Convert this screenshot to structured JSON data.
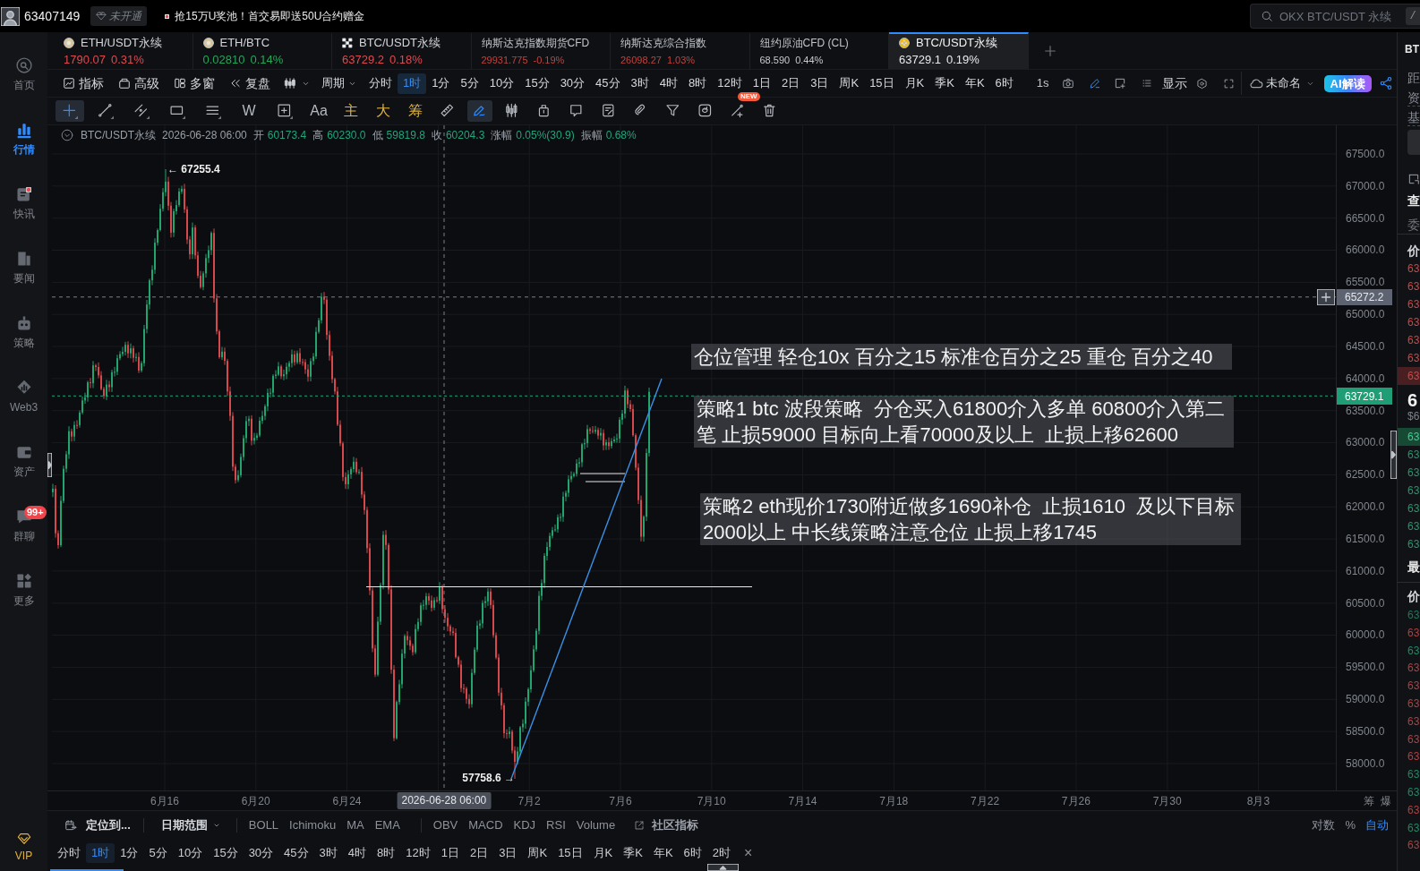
{
  "top_bar": {
    "account_id": "63407149",
    "membership_badge": "未开通",
    "promo_text": "抢15万U奖池！首交易即送50U合约赠金",
    "search": {
      "placeholder": "OKX BTC/USDT 永续",
      "shortcut": "/"
    }
  },
  "sidebar": {
    "items": [
      {
        "label": "首页",
        "selected": false,
        "unread": false
      },
      {
        "label": "行情",
        "selected": true,
        "unread": false
      },
      {
        "label": "快讯",
        "selected": false,
        "unread": true
      },
      {
        "label": "要闻",
        "selected": false,
        "unread": false
      },
      {
        "label": "策略",
        "selected": false,
        "unread": false
      },
      {
        "label": "Web3",
        "selected": false,
        "unread": false
      },
      {
        "label": "资产",
        "selected": false,
        "unread": false
      },
      {
        "label": "群聊",
        "selected": false,
        "unread": false,
        "badge": "99+"
      },
      {
        "label": "更多",
        "selected": false,
        "unread": false
      }
    ],
    "vip_label": "VIP"
  },
  "instrument_tabs": [
    {
      "kind": "pair",
      "name": "ETH/USDT永续",
      "price": "1790.07",
      "change": "0.31%",
      "color": "#e0494e",
      "selected": false
    },
    {
      "kind": "pair",
      "name": "ETH/BTC",
      "price": "0.02810",
      "change": "0.14%",
      "color": "#26a65b",
      "selected": false
    },
    {
      "kind": "pair",
      "name": "BTC/USDT永续",
      "price": "63729.2",
      "change": "0.18%",
      "color": "#e0494e",
      "selected": false
    },
    {
      "kind": "index",
      "name": "纳斯达克指数期货CFD",
      "price": "29931.775",
      "change": "-0.19%",
      "color": "#c0433f",
      "selected": false
    },
    {
      "kind": "index",
      "name": "纳斯达克综合指数",
      "price": "26098.27",
      "change": "1.03%",
      "color": "#c0433f",
      "selected": false
    },
    {
      "kind": "index",
      "name": "纽约原油CFD (CL)",
      "price": "68.590",
      "change": "0.44%",
      "color": "#c8cacd",
      "selected": false
    },
    {
      "kind": "pair",
      "name": "BTC/USDT永续",
      "price": "63729.1",
      "change": "0.19%",
      "color": "#e8e9eb",
      "selected": true
    }
  ],
  "toolbar": {
    "tools": [
      "指标",
      "高级",
      "多窗",
      "复盘"
    ],
    "period_label": "周期",
    "intervals": [
      {
        "label": "分时",
        "selected": false
      },
      {
        "label": "1时",
        "selected": true
      },
      {
        "label": "1分",
        "selected": false
      },
      {
        "label": "5分",
        "selected": false
      },
      {
        "label": "10分",
        "selected": false
      },
      {
        "label": "15分",
        "selected": false
      },
      {
        "label": "30分",
        "selected": false
      },
      {
        "label": "45分",
        "selected": false
      },
      {
        "label": "3时",
        "selected": false
      },
      {
        "label": "4时",
        "selected": false
      },
      {
        "label": "8时",
        "selected": false
      },
      {
        "label": "12时",
        "selected": false
      },
      {
        "label": "1日",
        "selected": false
      },
      {
        "label": "2日",
        "selected": false
      },
      {
        "label": "3日",
        "selected": false
      },
      {
        "label": "周K",
        "selected": false
      },
      {
        "label": "15日",
        "selected": false
      },
      {
        "label": "月K",
        "selected": false
      },
      {
        "label": "季K",
        "selected": false
      },
      {
        "label": "年K",
        "selected": false
      },
      {
        "label": "6时",
        "selected": false
      }
    ],
    "tick_interval": "1s",
    "display_label": "显示",
    "layout_name": "未命名",
    "ai_button": "AI解读"
  },
  "drawing_tools": [
    {
      "kind": "icon",
      "selected": true
    },
    {
      "kind": "icon",
      "selected": false
    },
    {
      "kind": "icon",
      "selected": false
    },
    {
      "kind": "icon",
      "selected": false
    },
    {
      "kind": "icon",
      "selected": false
    },
    {
      "kind": "text",
      "label": "W",
      "selected": false
    },
    {
      "kind": "icon",
      "selected": false
    },
    {
      "kind": "text",
      "label": "Aa",
      "selected": false
    },
    {
      "kind": "accent",
      "label": "主",
      "selected": false
    },
    {
      "kind": "accent",
      "label": "大",
      "selected": false
    },
    {
      "kind": "accent",
      "label": "筹",
      "selected": false
    },
    {
      "kind": "icon",
      "selected": false
    },
    {
      "kind": "icon",
      "selected": true
    },
    {
      "kind": "icon",
      "selected": false
    },
    {
      "kind": "icon",
      "selected": false
    },
    {
      "kind": "icon",
      "selected": false
    },
    {
      "kind": "icon",
      "selected": false
    },
    {
      "kind": "icon",
      "selected": false
    },
    {
      "kind": "icon",
      "selected": false
    },
    {
      "kind": "icon",
      "selected": false
    },
    {
      "kind": "icon",
      "selected": false,
      "badge": "NEW"
    },
    {
      "kind": "icon",
      "selected": false
    }
  ],
  "chart": {
    "symbol": "BTC/USDT永续",
    "time": "2026-06-28 06:00",
    "ohlc": [
      {
        "label": "开",
        "value": "60173.4"
      },
      {
        "label": "高",
        "value": "60230.0"
      },
      {
        "label": "低",
        "value": "59819.8"
      },
      {
        "label": "收",
        "value": "60204.3"
      },
      {
        "label": "涨幅",
        "value": "0.05%(30.9)"
      },
      {
        "label": "振幅",
        "value": "0.68%"
      }
    ],
    "high_label": "← 67255.4",
    "low_label": "57758.6 →",
    "notes": [
      "仓位管理 轻仓10x 百分之15 标准仓百分之25 重仓 百分之40",
      "策略1 btc 波段策略  分仓买入61800介入多单 60800介入第二笔 止损59000 目标向上看70000及以上  止损上移62600",
      "策略2 eth现价1730附近做多1690补仓  止损1610  及以下目标2000以上 中长线策略注意仓位 止损上移1745"
    ],
    "price_axis": [
      "67500.0",
      "67000.0",
      "66500.0",
      "66000.0",
      "65500.0",
      "65000.0",
      "64500.0",
      "64000.0",
      "63500.0",
      "63000.0",
      "62500.0",
      "62000.0",
      "61500.0",
      "61000.0",
      "60500.0",
      "60000.0",
      "59500.0",
      "59000.0",
      "58500.0",
      "58000.0"
    ],
    "crosshair_price": "65272.2",
    "last_price": "63729.1",
    "date_axis": [
      "6月16",
      "6月20",
      "6月24",
      "7月2",
      "7月6",
      "7月10",
      "7月14",
      "7月18",
      "7月22",
      "7月26",
      "7月30",
      "8月3"
    ],
    "cursor_time": "2026-06-28 06:00",
    "axis_corner": [
      "筹",
      "爆"
    ]
  },
  "indicator_bar": {
    "locate_label": "定位到...",
    "date_range_label": "日期范围",
    "main_indicators": [
      "BOLL",
      "Ichimoku",
      "MA",
      "EMA"
    ],
    "sub_indicators": [
      "OBV",
      "MACD",
      "KDJ",
      "RSI",
      "Volume"
    ],
    "community_label": "社区指标",
    "scale_options": [
      {
        "label": "对数",
        "selected": false
      },
      {
        "label": "%",
        "selected": false
      },
      {
        "label": "自动",
        "selected": true
      }
    ]
  },
  "bottom_intervals": {
    "items": [
      {
        "label": "分时",
        "selected": false
      },
      {
        "label": "1时",
        "selected": true
      },
      {
        "label": "1分",
        "selected": false
      },
      {
        "label": "5分",
        "selected": false
      },
      {
        "label": "10分",
        "selected": false
      },
      {
        "label": "15分",
        "selected": false
      },
      {
        "label": "30分",
        "selected": false
      },
      {
        "label": "45分",
        "selected": false
      },
      {
        "label": "3时",
        "selected": false
      },
      {
        "label": "4时",
        "selected": false
      },
      {
        "label": "8时",
        "selected": false
      },
      {
        "label": "12时",
        "selected": false
      },
      {
        "label": "1日",
        "selected": false
      },
      {
        "label": "2日",
        "selected": false
      },
      {
        "label": "3日",
        "selected": false
      },
      {
        "label": "周K",
        "selected": false
      },
      {
        "label": "15日",
        "selected": false
      },
      {
        "label": "月K",
        "selected": false
      },
      {
        "label": "季K",
        "selected": false
      },
      {
        "label": "年K",
        "selected": false
      },
      {
        "label": "6时",
        "selected": false
      },
      {
        "label": "2时",
        "selected": false
      }
    ],
    "close": "×"
  },
  "right_panel": {
    "title": "BT",
    "info_labels": [
      "距",
      "资",
      "基"
    ],
    "heading": "查",
    "subheading": "委",
    "book_header": "价",
    "asks": [
      {
        "text": "63",
        "highlighted": false
      },
      {
        "text": "63",
        "highlighted": false
      },
      {
        "text": "63",
        "highlighted": false
      },
      {
        "text": "63",
        "highlighted": false
      },
      {
        "text": "63",
        "highlighted": false
      },
      {
        "text": "63",
        "highlighted": false
      },
      {
        "text": "63",
        "highlighted": true
      }
    ],
    "last_price": "6",
    "last_price_usd": "$6",
    "bids": [
      {
        "text": "63",
        "highlighted": true
      },
      {
        "text": "63",
        "highlighted": false
      },
      {
        "text": "63",
        "highlighted": false
      },
      {
        "text": "63",
        "highlighted": false
      },
      {
        "text": "63",
        "highlighted": false
      },
      {
        "text": "63",
        "highlighted": false
      },
      {
        "text": "63",
        "highlighted": false
      }
    ],
    "trades_heading": "最",
    "trades_header": "价",
    "trades": [
      {
        "text": "63",
        "color": "#1d7a58"
      },
      {
        "text": "63",
        "color": "#b0403f"
      },
      {
        "text": "63",
        "color": "#1f8a63"
      },
      {
        "text": "63",
        "color": "#b0403f"
      },
      {
        "text": "63",
        "color": "#b0403f"
      },
      {
        "text": "63",
        "color": "#b0403f"
      },
      {
        "text": "63",
        "color": "#b0403f"
      },
      {
        "text": "63",
        "color": "#b0403f"
      },
      {
        "text": "63",
        "color": "#b0403f"
      },
      {
        "text": "63",
        "color": "#1f8a63"
      },
      {
        "text": "63",
        "color": "#1f8a63"
      },
      {
        "text": "63",
        "color": "#b0403f"
      },
      {
        "text": "63",
        "color": "#1f8a63"
      },
      {
        "text": "63",
        "color": "#b0403f"
      }
    ]
  }
}
